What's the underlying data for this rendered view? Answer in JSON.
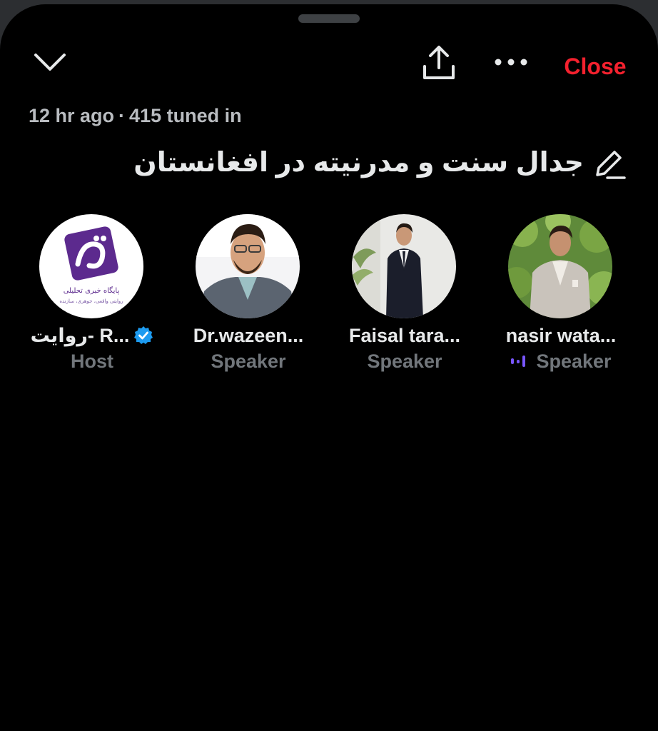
{
  "header": {
    "close_label": "Close",
    "chevron_icon": "chevron-down-icon",
    "share_icon": "share-icon",
    "more_icon": "more-icon"
  },
  "space": {
    "meta_time": "12 hr ago",
    "meta_separator": "·",
    "meta_listeners": "415 tuned in",
    "title": "جدال سنت و مدرنیته در افغانستان",
    "edit_icon": "pencil-icon"
  },
  "participants": [
    {
      "name": "روایت- R...",
      "role": "Host",
      "verified": true,
      "avatar_logo_text_1": "پایگاه خبری تحلیلی",
      "avatar_logo_text_2": "روایتی واقعی، جوهر‌ی، سازنده"
    },
    {
      "name": "Dr.wazeen...",
      "role": "Speaker"
    },
    {
      "name": "Faisal tara...",
      "role": "Speaker"
    },
    {
      "name": "nasir wata...",
      "role": "Speaker",
      "speaking": true
    }
  ],
  "colors": {
    "background": "#000000",
    "close_red": "#f4212e",
    "verified_blue": "#1d9bf0",
    "speaking_purple": "#7856ff",
    "muted_text": "#71767b"
  }
}
